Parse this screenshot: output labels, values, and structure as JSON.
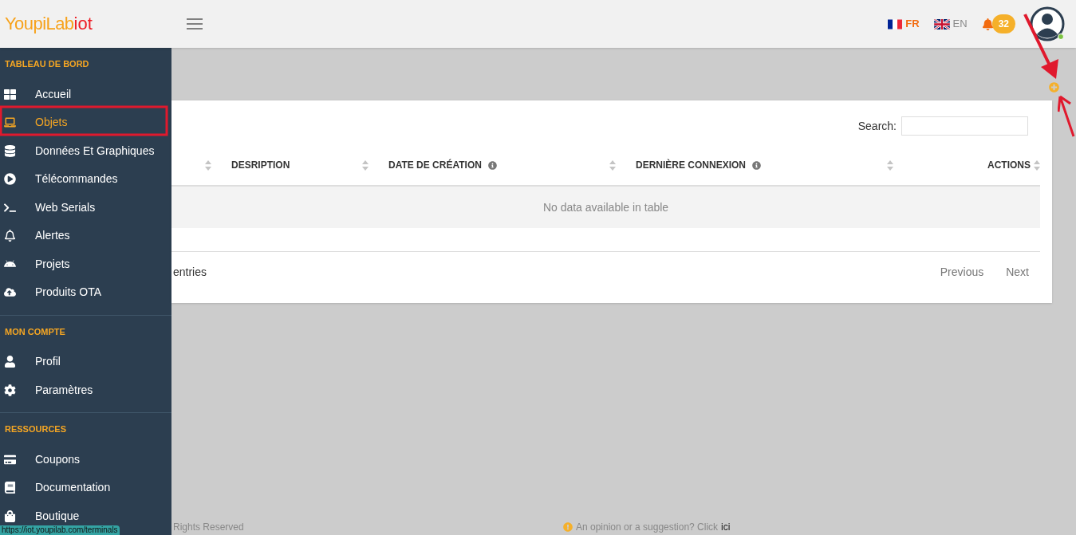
{
  "header": {
    "logo": {
      "main": "YoupiLab",
      "accent": "iot"
    },
    "languages": [
      {
        "code": "FR",
        "selected": true
      },
      {
        "code": "EN",
        "selected": false
      }
    ],
    "notifications": {
      "count": "32"
    },
    "user": {
      "online": true
    }
  },
  "sidebar": {
    "sections": [
      {
        "title": "TABLEAU DE BORD",
        "items": [
          {
            "label": "Accueil",
            "selected": false
          },
          {
            "label": "Objets",
            "selected": true
          },
          {
            "label": "Données Et Graphiques",
            "selected": false
          },
          {
            "label": "Télécommandes",
            "selected": false
          },
          {
            "label": "Web Serials",
            "selected": false
          },
          {
            "label": "Alertes",
            "selected": false
          },
          {
            "label": "Projets",
            "selected": false
          },
          {
            "label": "Produits OTA",
            "selected": false
          }
        ]
      },
      {
        "title": "MON COMPTE",
        "items": [
          {
            "label": "Profil",
            "selected": false
          },
          {
            "label": "Paramètres",
            "selected": false
          }
        ]
      },
      {
        "title": "RESSOURCES",
        "items": [
          {
            "label": "Coupons",
            "selected": false
          },
          {
            "label": "Documentation",
            "selected": false
          },
          {
            "label": "Boutique",
            "selected": false
          }
        ]
      }
    ]
  },
  "table": {
    "search_label": "Search:",
    "columns": [
      {
        "info": false
      },
      {
        "label": "DESRIPTION",
        "info": false
      },
      {
        "label": "DATE DE CRÉATION",
        "info": true
      },
      {
        "label": "DERNIÈRE CONNEXION",
        "info": true
      },
      {
        "label": "ACTIONS",
        "info": false
      }
    ],
    "empty_message": "No data available in table",
    "info": "entries",
    "pagination": [
      "Previous",
      "Next"
    ]
  },
  "footer": {
    "copyright": "Rights Reserved",
    "feedback": "An opinion or a suggestion? Click",
    "feedback_link": "ici"
  },
  "status_url": "https://iot.youpilab.com/terminals"
}
